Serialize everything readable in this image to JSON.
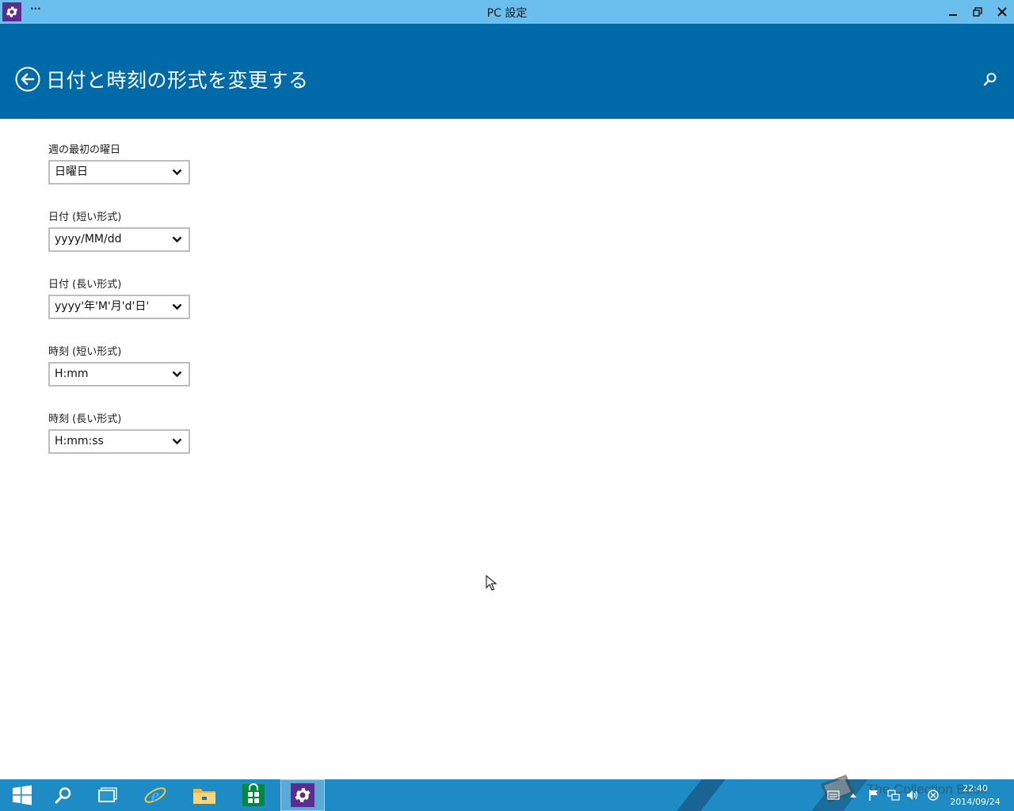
{
  "window": {
    "title": "PC 設定",
    "menu_label": "···",
    "controls": {
      "minimize": "minimize-icon",
      "restore": "restore-icon",
      "close": "close-icon"
    }
  },
  "header": {
    "title": "日付と時刻の形式を変更する",
    "back_icon": "back-arrow-icon",
    "search_icon": "search-icon"
  },
  "settings": [
    {
      "label": "週の最初の曜日",
      "value": "日曜日"
    },
    {
      "label": "日付 (短い形式)",
      "value": "yyyy/MM/dd"
    },
    {
      "label": "日付 (長い形式)",
      "value": "yyyy'年'M'月'd'日'"
    },
    {
      "label": "時刻 (短い形式)",
      "value": "H:mm"
    },
    {
      "label": "時刻 (長い形式)",
      "value": "H:mm:ss"
    }
  ],
  "taskbar": {
    "apps": [
      "start-icon",
      "search-icon",
      "task-view-icon",
      "internet-explorer-icon",
      "file-explorer-icon",
      "store-icon",
      "pc-settings-icon"
    ],
    "clock": {
      "time": "22:40",
      "date": "2014/09/24"
    },
    "watermark": "The Collection Book"
  },
  "colors": {
    "titlebar": "#6abfed",
    "header": "#006aa8",
    "taskbar": "#1f8bc4",
    "settings_app": "#5b2d91"
  }
}
